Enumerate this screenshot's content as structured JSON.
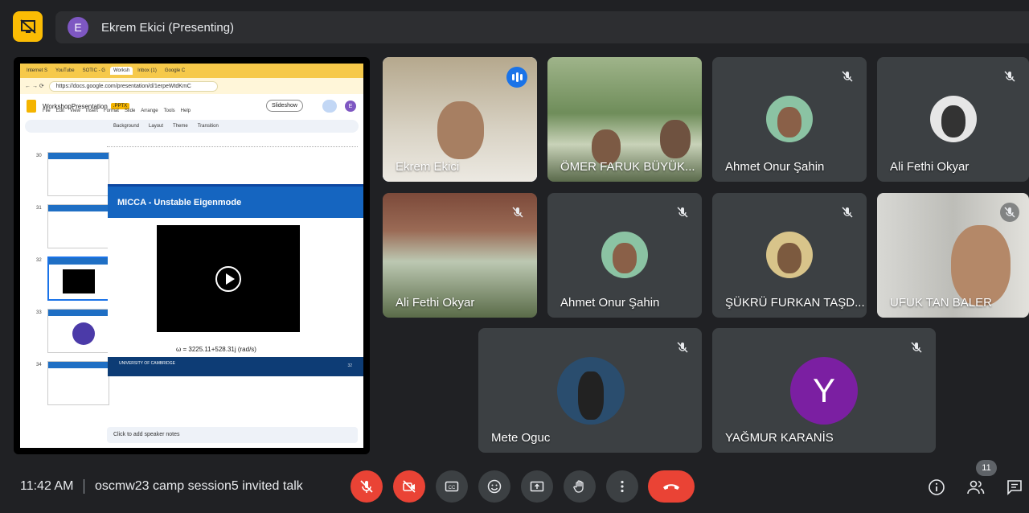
{
  "presenter_bar": {
    "avatar_letter": "E",
    "title": "Ekrem Ekici (Presenting)"
  },
  "shared_screen": {
    "tabs": [
      "Internet S",
      "YouTube",
      "SOTIC - G",
      "Worksh",
      "Inbox (1)",
      "Google C"
    ],
    "url": "https://docs.google.com/presentation/d/1erpeWtdKmC",
    "doc_title": "WorkshopPresentation",
    "doc_badge": ".PPTX",
    "menu": [
      "File",
      "Edit",
      "View",
      "Insert",
      "Format",
      "Slide",
      "Arrange",
      "Tools",
      "Help"
    ],
    "slideshow_label": "Slideshow",
    "user_initial": "E",
    "toolbar": [
      "Background",
      "Layout",
      "Theme",
      "Transition"
    ],
    "thumb_numbers": [
      "30",
      "31",
      "32",
      "33",
      "34"
    ],
    "slide_title": "MICCA - Unstable Eigenmode",
    "formula": "ω = 3225.11+528.31j (rad/s)",
    "footer_logo": "UNIVERSITY OF CAMBRIDGE",
    "slide_num": "32",
    "notes_placeholder": "Click to add speaker notes"
  },
  "participants": [
    {
      "name": "Ekrem Ekici"
    },
    {
      "name": "ÖMER FARUK BÜYÜK..."
    },
    {
      "name": "Ahmet Onur Şahin"
    },
    {
      "name": "Ali Fethi Okyar"
    },
    {
      "name": "Ali Fethi Okyar"
    },
    {
      "name": "Ahmet Onur Şahin"
    },
    {
      "name": "ŞÜKRÜ FURKAN TAŞD..."
    },
    {
      "name": "UFUK TAN BALER"
    },
    {
      "name": "Mete Oguc"
    },
    {
      "name": "YAĞMUR KARANİS",
      "avatar_letter": "Y"
    }
  ],
  "bottom": {
    "time": "11:42 AM",
    "meeting_name": "oscmw23 camp session5 invited talk",
    "participant_count": "11"
  },
  "colors": {
    "accent": "#8ab4f8",
    "danger": "#ea4335",
    "presenting": "#fbbc04"
  }
}
